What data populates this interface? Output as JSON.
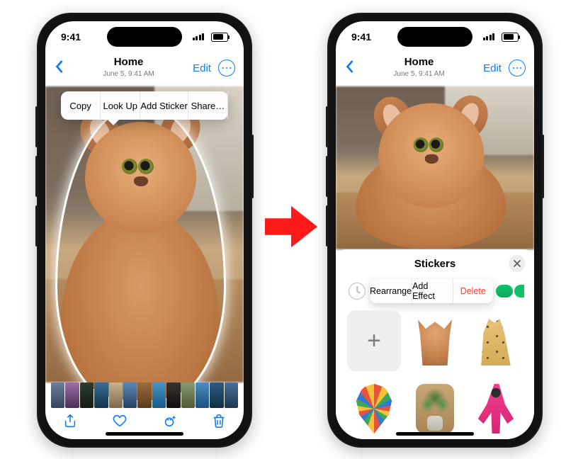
{
  "status": {
    "time": "9:41"
  },
  "nav": {
    "title": "Home",
    "subtitle": "June 5, 9:41 AM",
    "edit": "Edit"
  },
  "context_menu": {
    "copy": "Copy",
    "lookup": "Look Up",
    "add_sticker": "Add Sticker",
    "share": "Share…"
  },
  "stickers": {
    "title": "Stickers",
    "add_label": "+",
    "menu": {
      "rearrange": "Rearrange",
      "add_effect": "Add Effect",
      "delete": "Delete"
    }
  },
  "colors": {
    "ios_blue": "#0a7bff",
    "ios_red": "#ff3a30",
    "arrow_red": "#ff1a1a"
  },
  "filmstrip": [
    [
      "#6d7f9c",
      "#35425a"
    ],
    [
      "#9a6fa3",
      "#4a2e55"
    ],
    [
      "#2f3d33",
      "#121a14"
    ],
    [
      "#3a6d92",
      "#12324a"
    ],
    [
      "#c8b28f",
      "#7e6a4c"
    ],
    [
      "#5d88b5",
      "#23415f"
    ],
    [
      "#9e6b3d",
      "#5a3a1c"
    ],
    [
      "#4793c7",
      "#135a8a"
    ],
    [
      "#3a3230",
      "#120f0e"
    ],
    [
      "#8a9a6d",
      "#4d5a36"
    ],
    [
      "#4f8bc2",
      "#1c4f7d"
    ],
    [
      "#2d5a7d",
      "#0f2e46"
    ],
    [
      "#4b6f9a",
      "#1b3652"
    ]
  ]
}
